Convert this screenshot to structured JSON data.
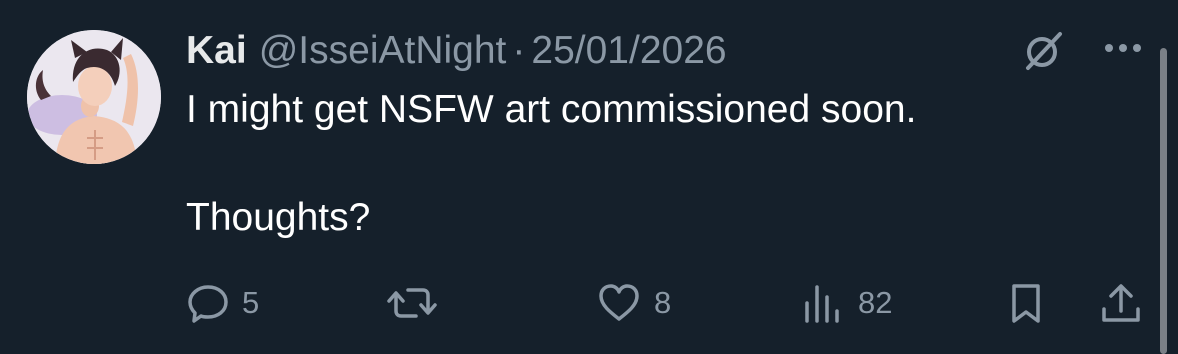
{
  "tweet": {
    "author_name": "Kai",
    "handle": "@IsseiAtNight",
    "separator": "·",
    "date": "25/01/2026",
    "text_line1": "I might get NSFW art commissioned soon.",
    "text_line2": "Thoughts?"
  },
  "actions": {
    "replies": "5",
    "likes": "8",
    "views": "82"
  },
  "icons": {
    "grok": "grok-icon",
    "more": "more-icon",
    "reply": "reply-icon",
    "retweet": "retweet-icon",
    "like": "heart-icon",
    "views": "views-icon",
    "bookmark": "bookmark-icon",
    "share": "share-icon"
  },
  "colors": {
    "background": "#15202b",
    "primary_text": "#e7e9ea",
    "secondary_text": "#8b98a5"
  }
}
